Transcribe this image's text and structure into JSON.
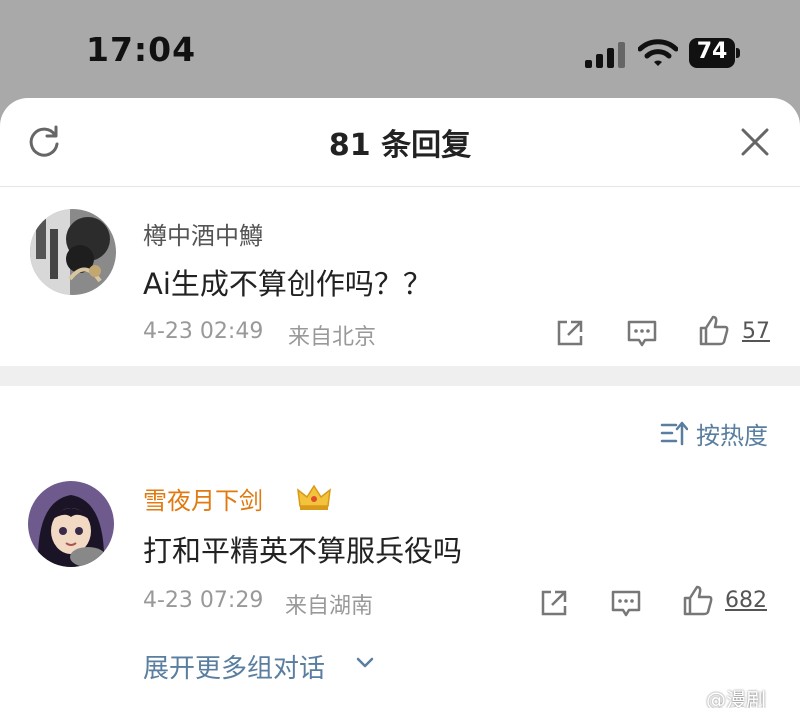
{
  "status_bar": {
    "time": "17:04",
    "battery": "74"
  },
  "sheet": {
    "title": "81 条回复",
    "refresh_icon": "refresh-icon",
    "close_icon": "close-icon"
  },
  "root_comment": {
    "author": "樽中酒中鱒",
    "text": "Ai生成不算创作吗？？",
    "time": "4-23 02:49",
    "location": "来自北京",
    "likes": "57"
  },
  "sort": {
    "label": "按热度"
  },
  "reply": {
    "author": "雪夜月下剑",
    "text": "打和平精英不算服兵役吗",
    "time": "4-23 07:29",
    "location": "来自湖南",
    "likes": "682",
    "expand_label": "展开更多组对话"
  },
  "watermark": "@漫剧",
  "colors": {
    "link": "#5a7ea0",
    "vip_name": "#e07a10",
    "meta": "#999999"
  }
}
